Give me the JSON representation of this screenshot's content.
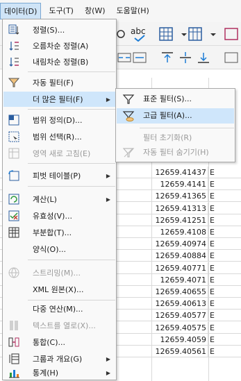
{
  "menubar": {
    "items": [
      {
        "label": "데이터(D)",
        "active": true
      },
      {
        "label": "도구(T)"
      },
      {
        "label": "창(W)"
      },
      {
        "label": "도움말(H)"
      }
    ]
  },
  "toolbar": {
    "abc_label": "abc"
  },
  "data_menu": {
    "items": [
      {
        "label": "정렬(S)...",
        "icon": "sort-icon"
      },
      {
        "label": "오름차순 정렬(A)",
        "icon": "sort-ascending-icon"
      },
      {
        "label": "내림차순 정렬(B)",
        "icon": "sort-descending-icon"
      },
      {
        "label": "자동 필터(F)",
        "icon": "autofilter-icon"
      },
      {
        "label": "더 많은 필터(F)",
        "icon": "",
        "submenu": true
      },
      {
        "label": "범위 정의(D)...",
        "icon": "define-range-icon"
      },
      {
        "label": "범위 선택(R)...",
        "icon": "select-range-icon"
      },
      {
        "label": "영역 새로 고침(E)",
        "icon": "refresh-range-icon",
        "disabled": true
      },
      {
        "label": "피벗 테이블(P)",
        "icon": "pivot-table-icon",
        "submenu": true
      },
      {
        "label": "계산(L)",
        "icon": "calculate-icon",
        "submenu": true
      },
      {
        "label": "유효성(V)...",
        "icon": "validity-icon"
      },
      {
        "label": "부분합(T)...",
        "icon": "subtotals-icon"
      },
      {
        "label": "양식(O)...",
        "icon": ""
      },
      {
        "label": "스트리밍(M)...",
        "icon": "streams-icon",
        "disabled": true
      },
      {
        "label": "XML 원본(X)...",
        "icon": ""
      },
      {
        "label": "다중 연산(M)...",
        "icon": ""
      },
      {
        "label": "텍스트를 열로(X)...",
        "icon": "text-to-columns-icon",
        "disabled": true
      },
      {
        "label": "통합(C)...",
        "icon": "consolidate-icon"
      },
      {
        "label": "그룹과 개요(G)",
        "icon": "group-outline-icon",
        "submenu": true
      },
      {
        "label": "통계(H)",
        "icon": "statistics-icon",
        "submenu": true
      }
    ]
  },
  "filter_submenu": {
    "items": [
      {
        "label": "표준 필터(S)...",
        "icon": "standard-filter-icon"
      },
      {
        "label": "고급 필터(A)...",
        "icon": "advanced-filter-icon",
        "highlight": true
      },
      {
        "label": "필터 초기화(R)",
        "icon": "",
        "disabled": true
      },
      {
        "label": "자동 필터 숨기기(H)",
        "icon": "hide-autofilter-icon",
        "disabled": true
      }
    ]
  },
  "sheet": {
    "rows": [
      {
        "value": "12659.41437",
        "code": "E"
      },
      {
        "value": "12659.4141",
        "code": "E"
      },
      {
        "value": "12659.41365",
        "code": "E"
      },
      {
        "value": "12659.41313",
        "code": "E"
      },
      {
        "value": "12659.41251",
        "code": "E"
      },
      {
        "value": "12659.4108",
        "code": "E"
      },
      {
        "value": "12659.40974",
        "code": "E"
      },
      {
        "value": "12659.40884",
        "code": "E"
      },
      {
        "value": "12659.40771",
        "code": "E"
      },
      {
        "value": "12659.4071",
        "code": "E"
      },
      {
        "value": "12659.40655",
        "code": "E"
      },
      {
        "value": "12659.40613",
        "code": "E"
      },
      {
        "value": "12659.40577",
        "code": "E"
      },
      {
        "value": "12659.40575",
        "code": "E"
      },
      {
        "value": "12659.4059",
        "code": "E"
      },
      {
        "value": "12659.40561",
        "code": "E"
      }
    ]
  }
}
